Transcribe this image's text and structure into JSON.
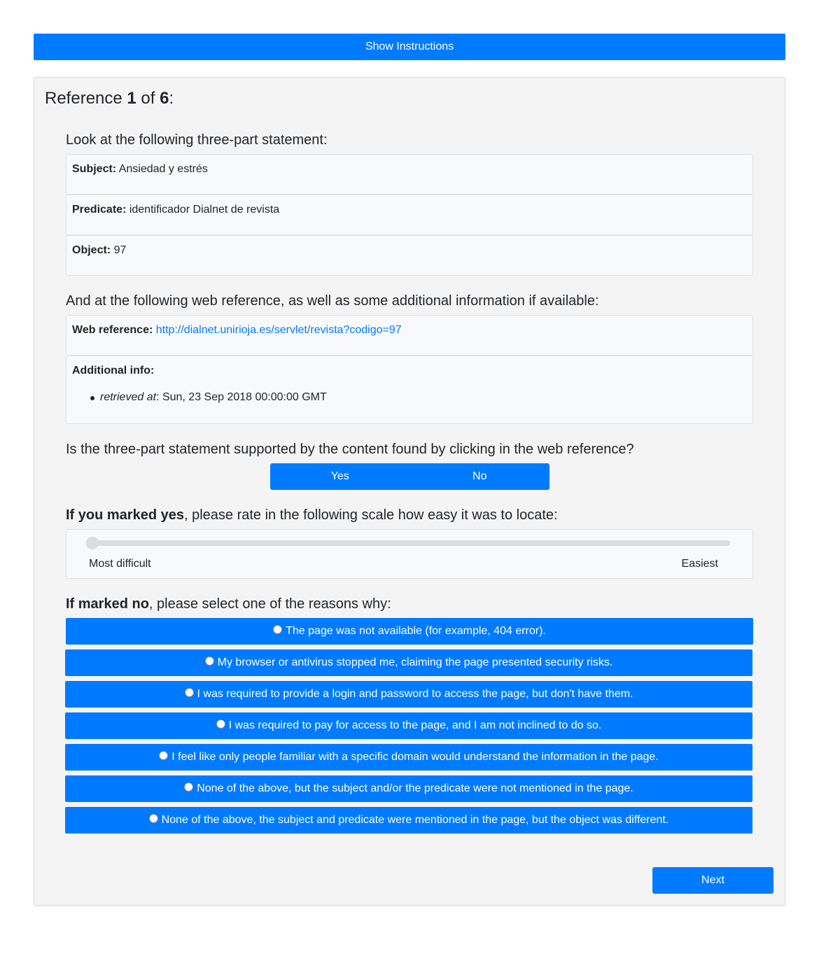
{
  "header": {
    "show_instructions_label": "Show Instructions"
  },
  "reference": {
    "title_prefix": "Reference ",
    "current": "1",
    "title_of": " of ",
    "total": "6",
    "title_suffix": ":"
  },
  "statement": {
    "intro": "Look at the following three-part statement:",
    "subject_label": "Subject:",
    "subject_value": "Ansiedad y estrés",
    "predicate_label": "Predicate:",
    "predicate_value": "identificador Dialnet de revista",
    "object_label": "Object:",
    "object_value": "97"
  },
  "web_reference": {
    "intro": "And at the following web reference, as well as some additional information if available:",
    "label": "Web reference:",
    "url": "http://dialnet.unirioja.es/servlet/revista?codigo=97",
    "additional_label": "Additional info:",
    "additional_items": [
      {
        "key": "retrieved at",
        "value": ": Sun, 23 Sep 2018 00:00:00 GMT"
      }
    ]
  },
  "support_question": {
    "text": "Is the three-part statement supported by the content found by clicking in the web reference?",
    "yes_label": "Yes",
    "no_label": "No"
  },
  "rating": {
    "prompt_bold": "If you marked yes",
    "prompt_rest": ", please rate in the following scale how easy it was to locate:",
    "min_label": "Most difficult",
    "max_label": "Easiest",
    "value_fraction": 0.0
  },
  "reasons": {
    "prompt_bold": "If marked no",
    "prompt_rest": ", please select one of the reasons why:",
    "options": [
      "The page was not available (for example, 404 error).",
      "My browser or antivirus stopped me, claiming the page presented security risks.",
      "I was required to provide a login and password to access the page, but don't have them.",
      "I was required to pay for access to the page, and I am not inclined to do so.",
      "I feel like only people familiar with a specific domain would understand the information in the page.",
      "None of the above, but the subject and/or the predicate were not mentioned in the page.",
      "None of the above, the subject and predicate were mentioned in the page, but the object was different."
    ]
  },
  "footer": {
    "next_label": "Next"
  },
  "colors": {
    "primary": "#007bff",
    "card_bg": "#f4f4f4",
    "box_bg": "#f8f9fa"
  }
}
